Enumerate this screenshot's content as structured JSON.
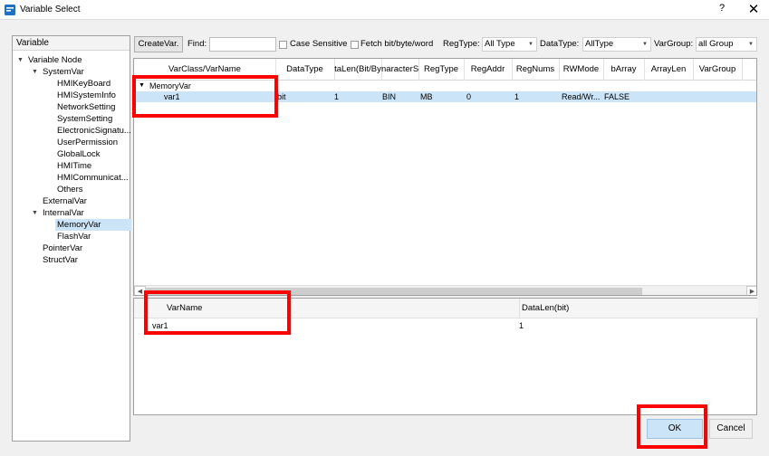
{
  "window": {
    "title": "Variable Select",
    "help": "?",
    "close": "✕"
  },
  "tree": {
    "header": "Variable",
    "nodes": {
      "root": "Variable Node",
      "systemvar": "SystemVar",
      "hmikeyboard": "HMIKeyBoard",
      "hmisysteminfo": "HMISystemInfo",
      "networksetting": "NetworkSetting",
      "systemsetting": "SystemSetting",
      "electronicsig": "ElectronicSignatu...",
      "userpermission": "UserPermission",
      "globallock": "GlobalLock",
      "hmitime": "HMITime",
      "hmicomm": "HMICommunicat...",
      "others": "Others",
      "externalvar": "ExternalVar",
      "internalvar": "InternalVar",
      "memoryvar": "MemoryVar",
      "flashvar": "FlashVar",
      "pointervar": "PointerVar",
      "structvar": "StructVar"
    }
  },
  "toolbar": {
    "create_label": "CreateVar.",
    "find_label": "Find:",
    "find_value": "",
    "case_sensitive": "Case Sensitive",
    "fetch_bit": "Fetch bit/byte/word",
    "regtype_label": "RegType:",
    "regtype_value": "All Type",
    "datatype_label": "DataType:",
    "datatype_value": "AllType",
    "vargroup_label": "VarGroup:",
    "vargroup_value": "all Group"
  },
  "grid": {
    "columns": [
      "VarClass/VarName",
      "DataType",
      "taLen(Bit/By",
      "naracterS",
      "RegType",
      "RegAddr",
      "RegNums",
      "RWMode",
      "bArray",
      "ArrayLen",
      "VarGroup"
    ],
    "group": "MemoryVar",
    "row": {
      "name": "var1",
      "datatype": "bit",
      "datalen": "1",
      "character": "BIN",
      "regtype": "MB",
      "regaddr": "0",
      "regnums": "1",
      "rwmode": "Read/Wr...",
      "barray": "FALSE"
    }
  },
  "selected": {
    "columns": [
      "VarName",
      "DataLen(bit)"
    ],
    "row": {
      "name": "var1",
      "datalen": "1"
    }
  },
  "footer": {
    "ok": "OK",
    "cancel": "Cancel"
  },
  "colors": {
    "selection": "#cce4f7",
    "highlight": "#ff0000"
  }
}
